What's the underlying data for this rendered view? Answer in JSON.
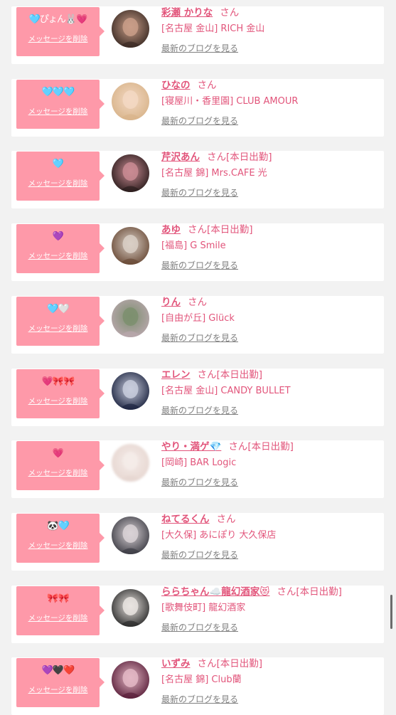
{
  "common": {
    "delete_label": "メッセージを削除",
    "blog_label": "最新のブログを見る",
    "san_label": "さん"
  },
  "items": [
    {
      "name": "彩瀬 かりな",
      "attendance": "",
      "shop": "[名古屋 金山] RICH 金山",
      "emoji": "🩵ぴょん🐰💗",
      "avatar_colors": [
        "#3a2a24",
        "#c99e88"
      ]
    },
    {
      "name": "ひなの",
      "attendance": "",
      "shop": "[寝屋川・香里園] CLUB AMOUR",
      "emoji": "🩵🩵🩵",
      "avatar_colors": [
        "#d8b48a",
        "#f3d8c3"
      ]
    },
    {
      "name": "芹沢あん",
      "attendance": "[本日出勤]",
      "shop": "[名古屋 錦] Mrs.CAFE 光",
      "emoji": "🩵",
      "avatar_colors": [
        "#2a1c1c",
        "#c98b93"
      ]
    },
    {
      "name": "あゆ",
      "attendance": "[本日出勤]",
      "shop": "[福島] G Smile",
      "emoji": "💜",
      "avatar_colors": [
        "#6a4a36",
        "#d9cfc6"
      ]
    },
    {
      "name": "りん",
      "attendance": "",
      "shop": "[自由が丘] Glück",
      "emoji": "🩵🤍",
      "avatar_colors": [
        "#b9a7ad",
        "#7c8f6f"
      ]
    },
    {
      "name": "エレン",
      "attendance": "[本日出勤]",
      "shop": "[名古屋 金山] CANDY BULLET",
      "emoji": "💗🎀🎀",
      "avatar_colors": [
        "#1c2440",
        "#c8ccdc"
      ]
    },
    {
      "name": "やり・満ゲ💎",
      "attendance": "[本日出勤]",
      "shop": "[岡崎] BAR Logic",
      "emoji": "💗",
      "avatar_colors": [
        "#e6d6d0",
        "#f5ece9"
      ]
    },
    {
      "name": "ねてるくん",
      "attendance": "",
      "shop": "[大久保] あにぽり 大久保店",
      "emoji": "🐼🩵",
      "avatar_colors": [
        "#3c3c44",
        "#d9d2d6"
      ]
    },
    {
      "name": "ららちゃん☁️龍幻酒家😻",
      "attendance": "[本日出勤]",
      "shop": "[歌舞伎町] 龍幻酒家",
      "emoji": "🎀🎀",
      "avatar_colors": [
        "#2b2b2b",
        "#e9e4e0"
      ]
    },
    {
      "name": "いずみ",
      "attendance": "[本日出勤]",
      "shop": "[名古屋 錦] Club蘭",
      "emoji": "💜🖤❤️",
      "avatar_colors": [
        "#5a1f3a",
        "#e3b7c4"
      ]
    }
  ]
}
